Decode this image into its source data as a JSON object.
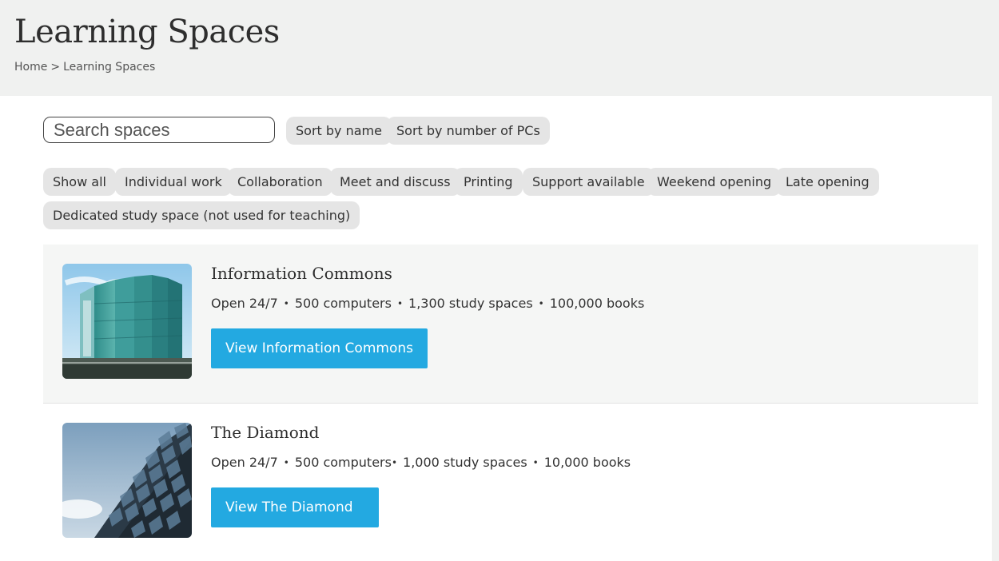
{
  "header": {
    "title": "Learning Spaces",
    "breadcrumb": {
      "home": "Home",
      "separator": ">",
      "current": "Learning Spaces"
    }
  },
  "search": {
    "placeholder": "Search spaces",
    "value": ""
  },
  "sort_buttons": [
    {
      "label": "Sort by name"
    },
    {
      "label": "Sort by number of PCs"
    }
  ],
  "filters": [
    {
      "label": "Show all"
    },
    {
      "label": "Individual work"
    },
    {
      "label": "Collaboration"
    },
    {
      "label": "Meet and discuss"
    },
    {
      "label": "Printing"
    },
    {
      "label": "Support available"
    },
    {
      "label": "Weekend opening"
    },
    {
      "label": "Late opening"
    },
    {
      "label": "Dedicated study space (not used for teaching)"
    }
  ],
  "spaces": [
    {
      "name": "Information Commons",
      "meta": [
        "Open 24/7",
        "500 computers",
        "1,300 study spaces",
        "100,000 books"
      ],
      "button": "View Information Commons",
      "image": "building-photo"
    },
    {
      "name": "The Diamond",
      "meta": [
        "Open 24/7",
        "500 computers",
        "1,000 study spaces",
        "10,000 books"
      ],
      "button": "View The Diamond",
      "image": "building-photo"
    }
  ],
  "colors": {
    "accent": "#23a9e1",
    "pill_bg": "#e5e5e5",
    "header_bg": "#f0f1f0",
    "card_shaded_bg": "#f5f6f5"
  }
}
